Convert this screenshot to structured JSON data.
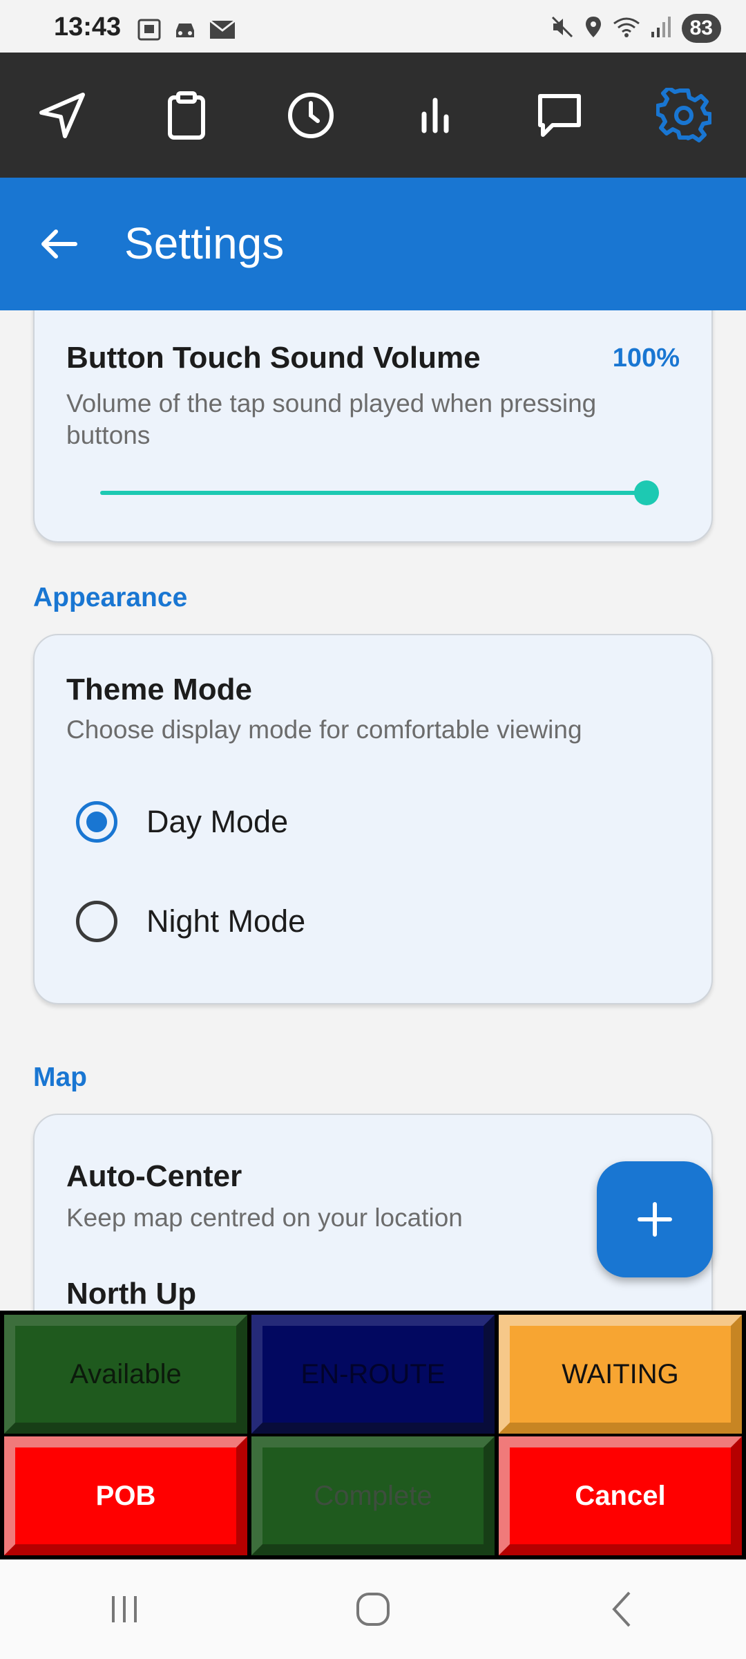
{
  "status_bar": {
    "time": "13:43",
    "left_icons": [
      "screenshot-icon",
      "car-icon",
      "mail-icon"
    ],
    "right_icons": [
      "mute-icon",
      "location-icon",
      "wifi-icon",
      "signal-icon"
    ],
    "battery": "83"
  },
  "top_nav": {
    "items": [
      {
        "icon": "navigation-icon",
        "active": false
      },
      {
        "icon": "clipboard-icon",
        "active": false
      },
      {
        "icon": "clock-icon",
        "active": false
      },
      {
        "icon": "stats-icon",
        "active": false
      },
      {
        "icon": "message-icon",
        "active": false
      },
      {
        "icon": "gear-icon",
        "active": true
      }
    ]
  },
  "app_bar": {
    "title": "Settings"
  },
  "sound": {
    "title": "Button Touch Sound Volume",
    "value_label": "100%",
    "description_line1": "Volume of the tap sound played when pressing",
    "description_line2": "buttons",
    "slider_value": 1.0
  },
  "appearance": {
    "header": "Appearance",
    "title": "Theme Mode",
    "description": "Choose display mode for comfortable viewing",
    "options": [
      {
        "label": "Day Mode",
        "selected": true
      },
      {
        "label": "Night Mode",
        "selected": false
      }
    ]
  },
  "map": {
    "header": "Map",
    "auto_center_title": "Auto-Center",
    "auto_center_desc": "Keep map centred on your location",
    "north_up_title": "North Up"
  },
  "fab": {
    "icon": "plus-icon"
  },
  "status_buttons": [
    {
      "label": "Available",
      "style": "green"
    },
    {
      "label": "EN-ROUTE",
      "style": "navy"
    },
    {
      "label": "WAITING",
      "style": "orange"
    },
    {
      "label": "POB",
      "style": "red"
    },
    {
      "label": "Complete",
      "style": "green-disabled"
    },
    {
      "label": "Cancel",
      "style": "red"
    }
  ],
  "colors": {
    "primary": "#1976d2",
    "nav_bg": "#2e2e2e",
    "slider": "#1dc9b2",
    "active_nav_icon": "#1976d2"
  }
}
